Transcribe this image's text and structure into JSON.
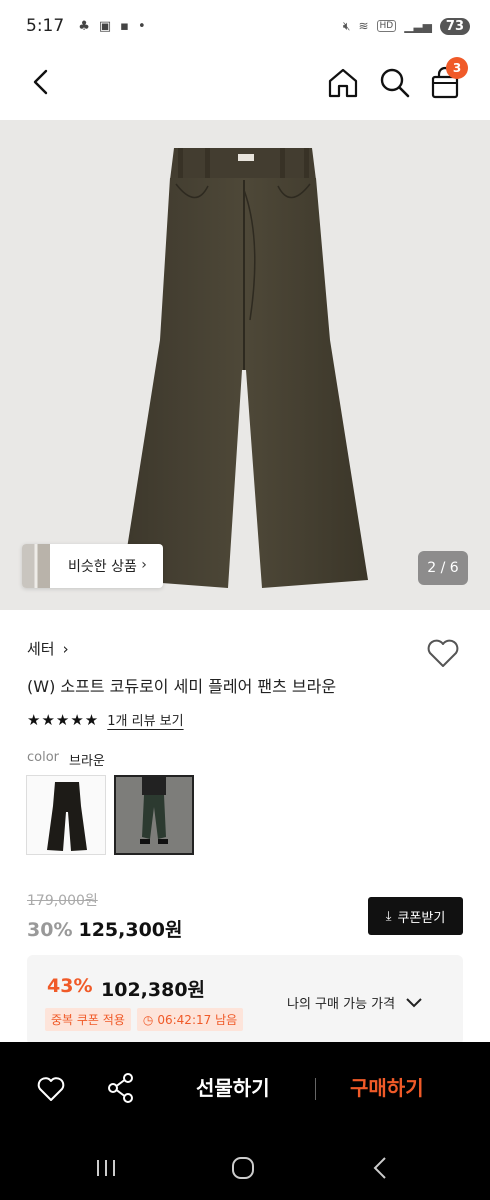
{
  "status_bar": {
    "time": "5:17",
    "battery": "73",
    "hd": "HD"
  },
  "nav": {
    "bag_count": "3"
  },
  "gallery": {
    "similar_label": "비슷한 상품",
    "counter": "2 / 6"
  },
  "product": {
    "brand": "세터",
    "name": "(W) 소프트 코듀로이 세미 플레어 팬츠 브라운",
    "stars": "★★★★★",
    "review_link": "1개 리뷰 보기",
    "color_label": "color",
    "color_value": "브라운"
  },
  "price": {
    "original": "179,000원",
    "discount": "30%",
    "current": "125,300원",
    "coupon_button": "쿠폰받기"
  },
  "benefit": {
    "discount": "43%",
    "price": "102,380원",
    "tag_coupon": "중복 쿠폰 적용",
    "tag_timer": "06:42:17 남음",
    "my_price_label": "나의 구매 가능 가격"
  },
  "action_bar": {
    "gift": "선물하기",
    "buy": "구매하기"
  },
  "colors": {
    "accent": "#f05a28",
    "dark": "#111111",
    "pants": "#4a4435"
  }
}
